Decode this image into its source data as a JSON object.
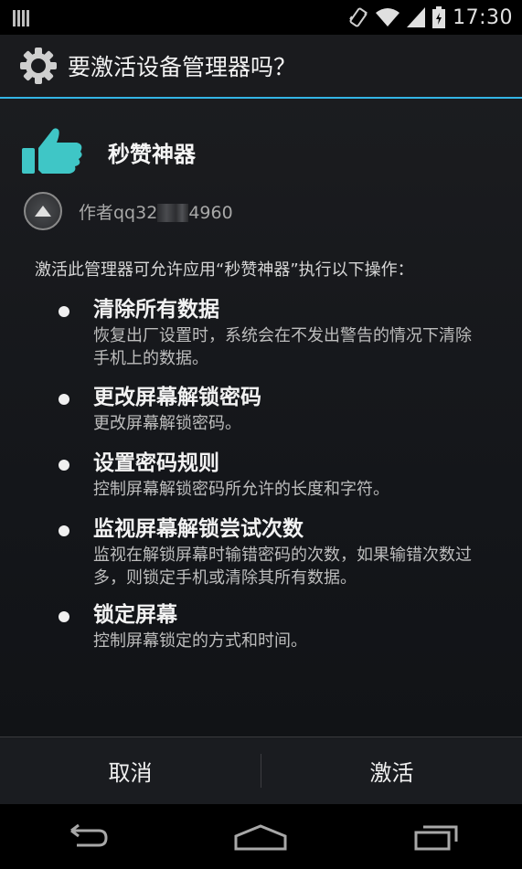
{
  "status_bar": {
    "time": "17:30",
    "icons": [
      "notification-icon",
      "vibrate-icon",
      "wifi-icon",
      "signal-icon",
      "battery-icon"
    ]
  },
  "dialog": {
    "title": "要激活设备管理器吗？",
    "title_icon": "gear-icon",
    "app": {
      "icon": "thumbs-up-icon",
      "name": "秒赞神器",
      "accent": "#3fc6c6"
    },
    "author": {
      "prefix": "作者qq32",
      "suffix": "4960"
    },
    "description": "激活此管理器可允许应用“秒赞神器”执行以下操作：",
    "permissions": [
      {
        "title": "清除所有数据",
        "desc": "恢复出厂设置时，系统会在不发出警告的情况下清除手机上的数据。"
      },
      {
        "title": "更改屏幕解锁密码",
        "desc": "更改屏幕解锁密码。"
      },
      {
        "title": "设置密码规则",
        "desc": "控制屏幕解锁密码所允许的长度和字符。"
      },
      {
        "title": "监视屏幕解锁尝试次数",
        "desc": "监视在解锁屏幕时输错密码的次数，如果输错次数过多，则锁定手机或清除其所有数据。"
      },
      {
        "title": "锁定屏幕",
        "desc": "控制屏幕锁定的方式和时间。"
      }
    ],
    "buttons": {
      "cancel": "取消",
      "activate": "激活"
    }
  },
  "nav_bar": {
    "icons": [
      "back-icon",
      "home-icon",
      "recents-icon"
    ]
  },
  "colors": {
    "accent_line": "#33b5e5",
    "app_icon": "#3fc6c6"
  }
}
